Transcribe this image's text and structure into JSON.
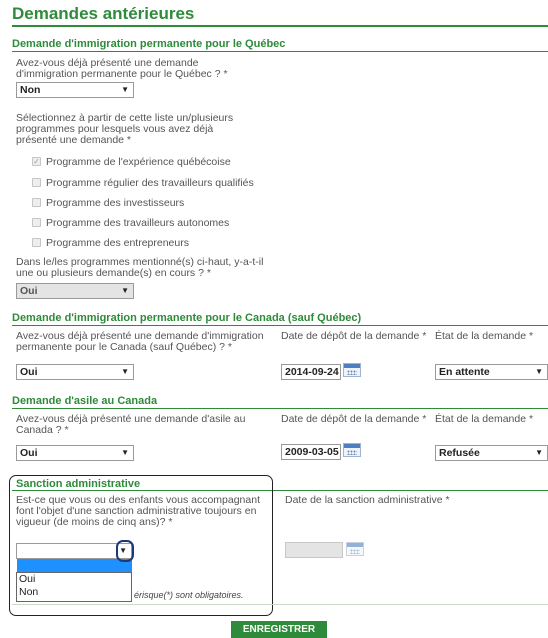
{
  "page_title": "Demandes antérieures",
  "quebec": {
    "heading": "Demande d'immigration permanente pour le Québec",
    "q1": "Avez-vous déjà présenté une demande d'immigration permanente pour le Québec ? *",
    "q1_value": "Non",
    "q2": "Sélectionnez à partir de cette liste un/plusieurs programmes pour lesquels vous avez déjà présenté une demande *",
    "programs": [
      {
        "label": "Programme de l'expérience québécoise",
        "checked": true
      },
      {
        "label": "Programme régulier des travailleurs qualifiés",
        "checked": false
      },
      {
        "label": "Programme des investisseurs",
        "checked": false
      },
      {
        "label": "Programme des travailleurs autonomes",
        "checked": false
      },
      {
        "label": "Programme des entrepreneurs",
        "checked": false
      }
    ],
    "q3": "Dans le/les programmes mentionné(s) ci-haut, y-a-t-il une ou plusieurs demande(s) en cours ? *",
    "q3_value": "Oui"
  },
  "canada": {
    "heading": "Demande d'immigration permanente pour le Canada (sauf Québec)",
    "q": "Avez-vous déjà présenté une demande d'immigration permanente pour le Canada (sauf Québec) ? *",
    "q_value": "Oui",
    "date_label": "Date de dépôt de la demande *",
    "date_value": "2014-09-24",
    "state_label": "État de la demande *",
    "state_value": "En attente"
  },
  "asile": {
    "heading": "Demande d'asile au Canada",
    "q": "Avez-vous déjà présenté une demande d'asile au Canada ? *",
    "q_value": "Oui",
    "date_label": "Date de dépôt de la demande *",
    "date_value": "2009-03-05",
    "state_label": "État de la demande *",
    "state_value": "Refusée"
  },
  "sanction": {
    "heading": "Sanction administrative",
    "q": "Est-ce que vous ou des enfants vous accompagnant font l'objet d'une sanction administrative toujours en vigueur (de moins de cinq ans)? *",
    "q_value": "",
    "options": [
      "Oui",
      "Non"
    ],
    "date_label": "Date de la sanction administrative *"
  },
  "footnote": "érisque(*) sont obligatoires.",
  "submit_label": "ENREGISTRER",
  "colors": {
    "accent": "#2e8b3a",
    "highlight": "#1e90ff"
  }
}
